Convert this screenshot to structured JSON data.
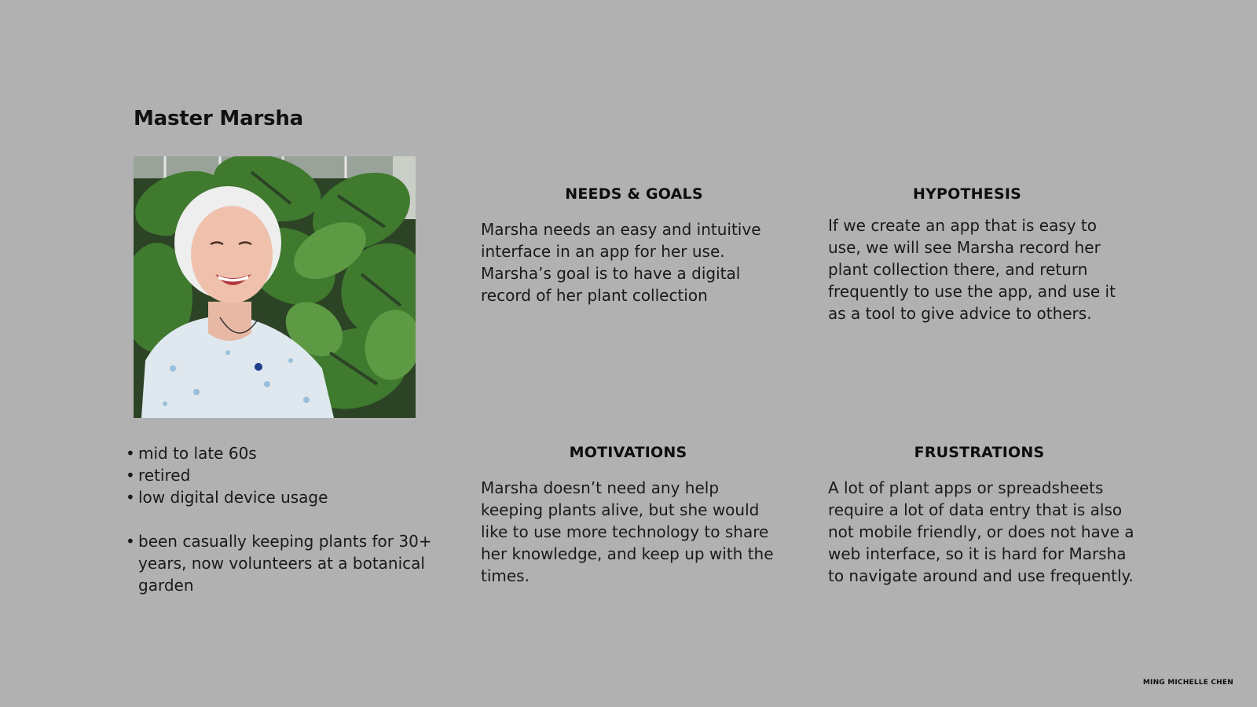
{
  "persona": {
    "name": "Master Marsha",
    "photo_icon": "persona-photo"
  },
  "demographics": {
    "items": [
      "mid to late 60s",
      "retired",
      "low digital device usage",
      "been casually keeping plants for 30+ years, now volunteers at a botanical garden"
    ]
  },
  "needs_goals": {
    "heading": "NEEDS & GOALS",
    "text": "Marsha needs an easy and intuitive interface in an app for her use. Marsha’s goal is to have a digital record of her plant collection"
  },
  "hypothesis": {
    "heading": "HYPOTHESIS",
    "text": "If we create an app that is easy to use, we will see Marsha record her plant collection there, and return frequently to use the app, and use it as a tool to give advice to others."
  },
  "motivations": {
    "heading": "MOTIVATIONS",
    "text": "Marsha doesn’t need any help keeping plants alive, but she would like to use more technology to share her knowledge, and keep up with the times."
  },
  "frustrations": {
    "heading": "FRUSTRATIONS",
    "text": "A lot of plant apps or spreadsheets require a lot of data entry that is also not mobile friendly, or does not have a web interface, so it is hard for Marsha to navigate around and use frequently."
  },
  "footer": {
    "author": "MING MICHELLE CHEN"
  },
  "colors": {
    "background": "#b1b1b1",
    "text": "#111111"
  }
}
